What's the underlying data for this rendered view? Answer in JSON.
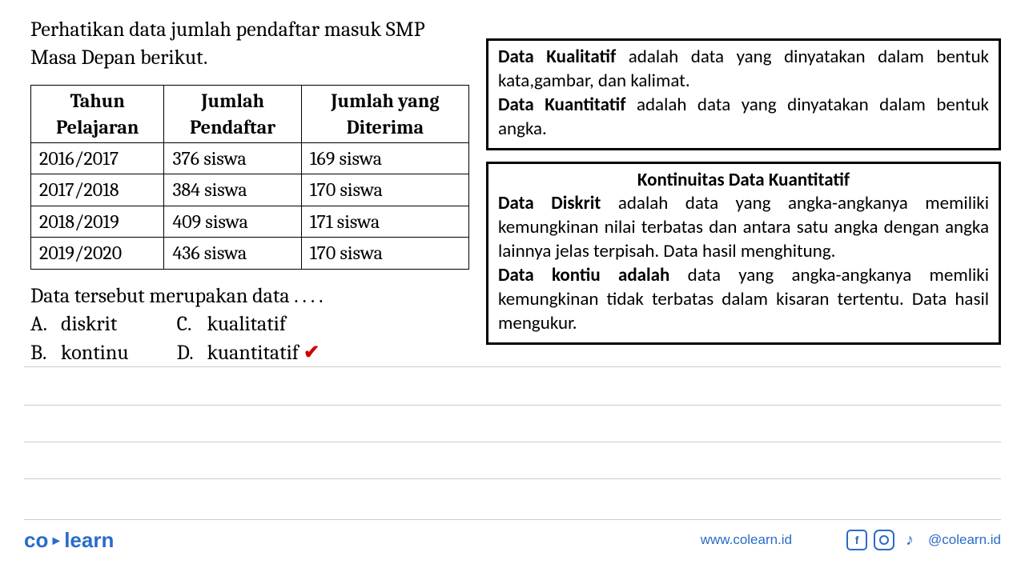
{
  "intro": "Perhatikan data jumlah pendaftar masuk SMP Masa Depan berikut.",
  "table_headers": {
    "c1a": "Tahun",
    "c1b": "Pelajaran",
    "c2a": "Jumlah",
    "c2b": "Pendaftar",
    "c3a": "Jumlah yang",
    "c3b": "Diterima"
  },
  "rows": [
    {
      "year": "2016/2017",
      "pendaftar": "376 siswa",
      "diterima": "169 siswa"
    },
    {
      "year": "2017/2018",
      "pendaftar": "384 siswa",
      "diterima": "170 siswa"
    },
    {
      "year": "2018/2019",
      "pendaftar": "409 siswa",
      "diterima": "171 siswa"
    },
    {
      "year": "2019/2020",
      "pendaftar": "436 siswa",
      "diterima": "170 siswa"
    }
  ],
  "question": "Data tersebut merupakan data . . . .",
  "options": {
    "A": {
      "letter": "A.",
      "text": "diskrit"
    },
    "B": {
      "letter": "B.",
      "text": "kontinu"
    },
    "C": {
      "letter": "C.",
      "text": "kualitatif"
    },
    "D": {
      "letter": "D.",
      "text": "kuantitatif"
    }
  },
  "checkmark": "✔",
  "box1": {
    "l1a": "Data Kualitatif",
    "l1b": " adalah data yang dinyatakan dalam bentuk kata,gambar, dan kalimat.",
    "l2a": "Data Kuantitatif",
    "l2b": " adalah data yang dinyatakan dalam bentuk angka."
  },
  "box2": {
    "title": "Kontinuitas Data Kuantitatif",
    "l1a": "Data Diskrit",
    "l1b": " adalah data yang angka-angkanya memiliki kemungkinan nilai terbatas dan antara satu angka dengan angka lainnya  jelas terpisah. Data hasil menghitung.",
    "l2a": "Data kontiu adalah",
    "l2b": " data yang angka-angkanya memliki kemungkinan tidak terbatas dalam kisaran tertentu. Data hasil mengukur."
  },
  "footer": {
    "logo_a": "co",
    "logo_b": "learn",
    "url": "www.colearn.id",
    "handle": "@colearn.id",
    "fb": "f",
    "tiktok": "♪"
  }
}
